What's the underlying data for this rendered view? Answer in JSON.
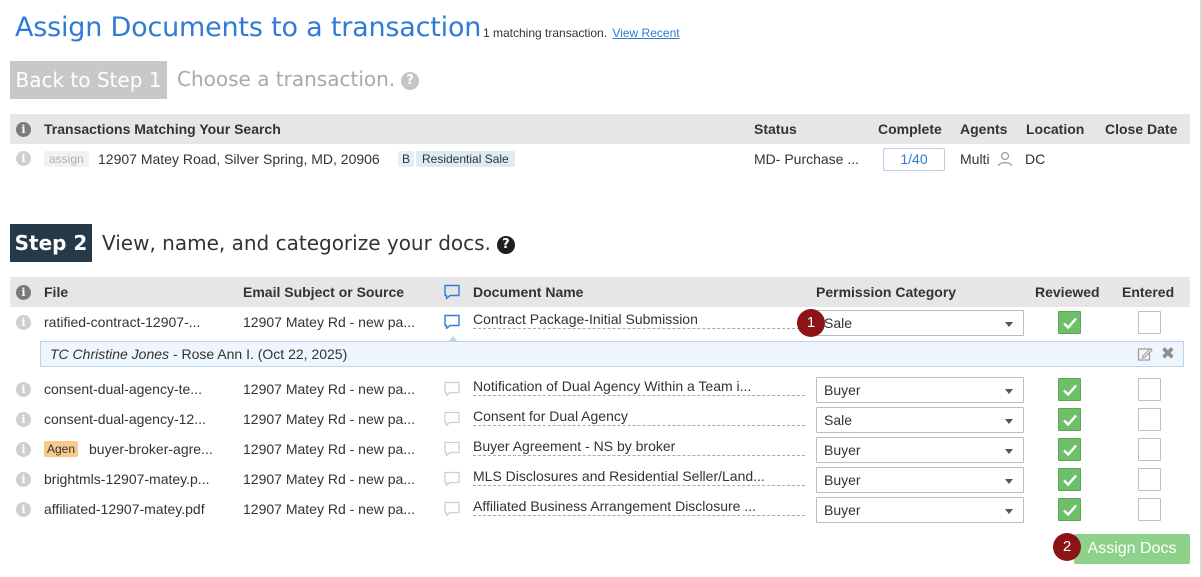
{
  "header": {
    "title": "Assign Documents to a transaction",
    "match_count": "1 matching transaction.",
    "view_recent": "View Recent"
  },
  "step1": {
    "back_label": "Back to Step 1",
    "instruction": "Choose a transaction.",
    "help_glyph": "?"
  },
  "transactions_table": {
    "columns": [
      "Transactions Matching Your Search",
      "Status",
      "Complete",
      "Agents",
      "Location",
      "Close Date"
    ],
    "rows": [
      {
        "assign": "assign",
        "address": "12907 Matey Road, Silver Spring, MD, 20906",
        "b_tag": "B",
        "type_tag": "Residential Sale",
        "status": "MD- Purchase ...",
        "complete": "1/40",
        "agents": "Multi",
        "location": "DC",
        "close_date": ""
      }
    ]
  },
  "step2": {
    "badge": "Step 2",
    "instruction": "View, name, and categorize your docs.",
    "help_glyph": "?"
  },
  "docs_table": {
    "columns": [
      "File",
      "Email Subject or Source",
      "Document Name",
      "Permission Category",
      "Reviewed",
      "Entered"
    ],
    "rows": [
      {
        "tag": "",
        "file": "ratified-contract-12907-...",
        "subject": "12907 Matey Rd - new pa...",
        "doc_name": "Contract Package-Initial Submission",
        "category": "Sale",
        "reviewed": true,
        "entered": false,
        "chat_active": true
      },
      {
        "tag": "",
        "file": "consent-dual-agency-te...",
        "subject": "12907 Matey Rd - new pa...",
        "doc_name": "Notification of Dual Agency Within a Team i...",
        "category": "Buyer",
        "reviewed": true,
        "entered": false,
        "chat_active": false
      },
      {
        "tag": "",
        "file": "consent-dual-agency-12...",
        "subject": "12907 Matey Rd - new pa...",
        "doc_name": "Consent for Dual Agency",
        "category": "Sale",
        "reviewed": true,
        "entered": false,
        "chat_active": false
      },
      {
        "tag": "Agen",
        "file": "buyer-broker-agre...",
        "subject": "12907 Matey Rd - new pa...",
        "doc_name": "Buyer Agreement - NS by broker",
        "category": "Buyer",
        "reviewed": true,
        "entered": false,
        "chat_active": false
      },
      {
        "tag": "",
        "file": "brightmls-12907-matey.p...",
        "subject": "12907 Matey Rd - new pa...",
        "doc_name": "MLS Disclosures and Residential Seller/Land...",
        "category": "Buyer",
        "reviewed": true,
        "entered": false,
        "chat_active": false
      },
      {
        "tag": "",
        "file": "affiliated-12907-matey.pdf",
        "subject": "12907 Matey Rd - new pa...",
        "doc_name": "Affiliated Business Arrangement Disclosure ...",
        "category": "Buyer",
        "reviewed": true,
        "entered": false,
        "chat_active": false
      }
    ]
  },
  "comment": {
    "author_role": "TC Christine Jones",
    "text": "- Rose Ann I. (Oct 22, 2025)"
  },
  "callouts": {
    "one": "1",
    "two": "2"
  },
  "assign_button": "Assign Docs",
  "colors": {
    "title_blue": "#2f7bd5",
    "step2_dark": "#253949",
    "check_green": "#6fbf6a",
    "assign_green": "#8ed18a",
    "callout_red": "#8c1416",
    "header_grey": "#e6e6e6"
  },
  "icons": [
    "info-icon",
    "help-icon",
    "person-icon",
    "chat-icon",
    "checkmark-icon",
    "edit-icon",
    "close-icon",
    "caret-down-icon"
  ]
}
